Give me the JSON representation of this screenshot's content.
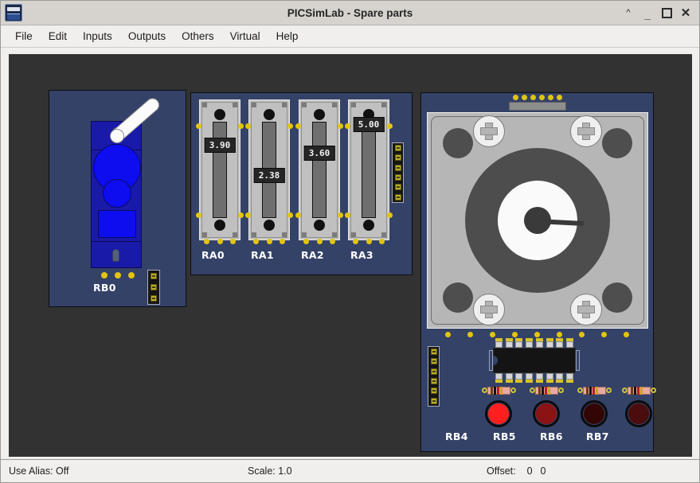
{
  "window": {
    "title": "PICSimLab - Spare parts",
    "icon": "app-icon",
    "buttons": [
      {
        "name": "shade",
        "glyph": "⌃"
      },
      {
        "name": "minimize",
        "glyph": "–"
      },
      {
        "name": "maximize",
        "glyph": ""
      },
      {
        "name": "close",
        "glyph": "✕"
      }
    ]
  },
  "menubar": {
    "items": [
      "File",
      "Edit",
      "Inputs",
      "Outputs",
      "Others",
      "Virtual",
      "Help"
    ]
  },
  "canvas": {
    "background": "#323232",
    "panel_color": "#344268"
  },
  "parts": {
    "servo": {
      "label": "RB0",
      "arm_angle_deg": -41,
      "body_color": "#0d0df0",
      "connector_pins": 3
    },
    "potentiometers": {
      "labels": [
        "RA0",
        "RA1",
        "RA2",
        "RA3"
      ],
      "values": [
        "3.90",
        "2.38",
        "3.60",
        "5.00"
      ],
      "value_max": "5.00",
      "connector_pins": 6
    },
    "stepper": {
      "header_dots": 6,
      "screws": 4,
      "shaft_angle_deg": 3
    },
    "leds": {
      "labels": [
        "RB4",
        "RB5",
        "RB6",
        "RB7"
      ],
      "colors": [
        "#ff1f1f",
        "#8b1313",
        "#330606",
        "#4a0c0c"
      ],
      "connector_pins": 6
    },
    "ic": {
      "pins_per_side": 8,
      "resistor_count": 4
    }
  },
  "statusbar": {
    "use_alias_label": "Use Alias: Off",
    "scale_label": "Scale: 1.0",
    "offset_label": "Offset:",
    "offset_x": "0",
    "offset_y": "0"
  }
}
